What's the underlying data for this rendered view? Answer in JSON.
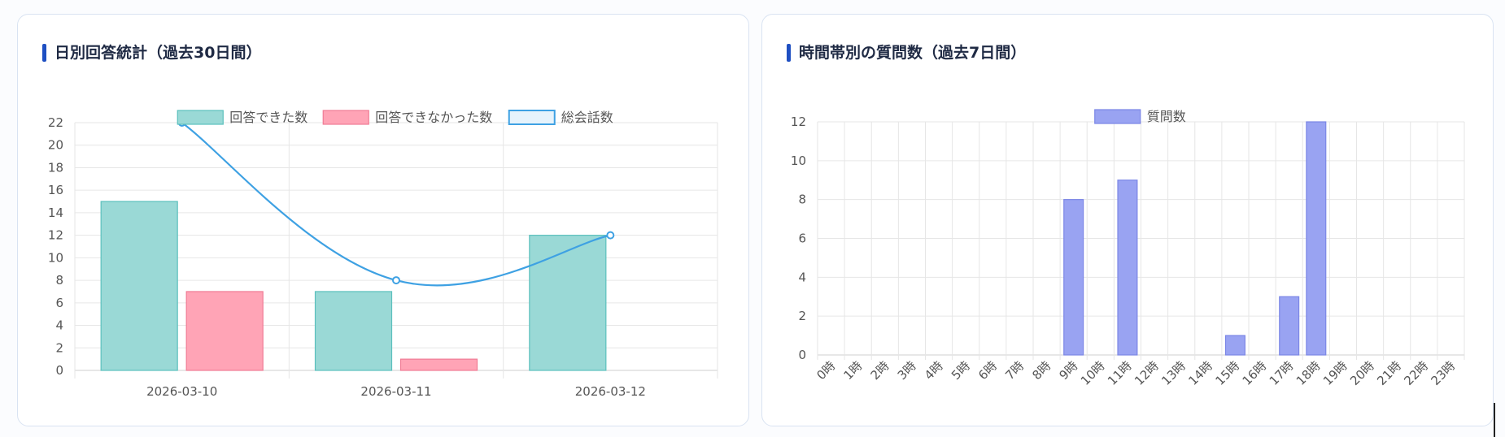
{
  "chart_data": [
    {
      "type": "bar",
      "title": "日別回答統計（過去30日間）",
      "categories": [
        "2026-03-10",
        "2026-03-11",
        "2026-03-12"
      ],
      "series": [
        {
          "name": "回答できた数",
          "type": "bar",
          "values": [
            15,
            7,
            12
          ],
          "fill": "#9ad9d6",
          "stroke": "#5bc0bd"
        },
        {
          "name": "回答できなかった数",
          "type": "bar",
          "values": [
            7,
            1,
            0
          ],
          "fill": "#ffa4b6",
          "stroke": "#f07c95"
        },
        {
          "name": "総会話数",
          "type": "line",
          "values": [
            22,
            8,
            12
          ],
          "stroke": "#3ea1e3"
        }
      ],
      "ylim": [
        0,
        22
      ],
      "yticks": [
        "0",
        "2",
        "4",
        "6",
        "8",
        "10",
        "12",
        "14",
        "16",
        "18",
        "20",
        "22"
      ],
      "grid": true,
      "legend": "top"
    },
    {
      "type": "bar",
      "title": "時間帯別の質問数（過去7日間）",
      "categories": [
        "0時",
        "1時",
        "2時",
        "3時",
        "4時",
        "5時",
        "6時",
        "7時",
        "8時",
        "9時",
        "10時",
        "11時",
        "12時",
        "13時",
        "14時",
        "15時",
        "16時",
        "17時",
        "18時",
        "19時",
        "20時",
        "21時",
        "22時",
        "23時"
      ],
      "series": [
        {
          "name": "質問数",
          "type": "bar",
          "values": [
            0,
            0,
            0,
            0,
            0,
            0,
            0,
            0,
            0,
            8,
            0,
            9,
            0,
            0,
            0,
            1,
            0,
            3,
            12,
            0,
            0,
            0,
            0,
            0
          ],
          "fill": "#99a3f2",
          "stroke": "#7b86e6"
        }
      ],
      "ylim": [
        0,
        12
      ],
      "yticks": [
        "0",
        "2",
        "4",
        "6",
        "8",
        "10",
        "12"
      ],
      "grid": true,
      "legend": "top"
    }
  ]
}
